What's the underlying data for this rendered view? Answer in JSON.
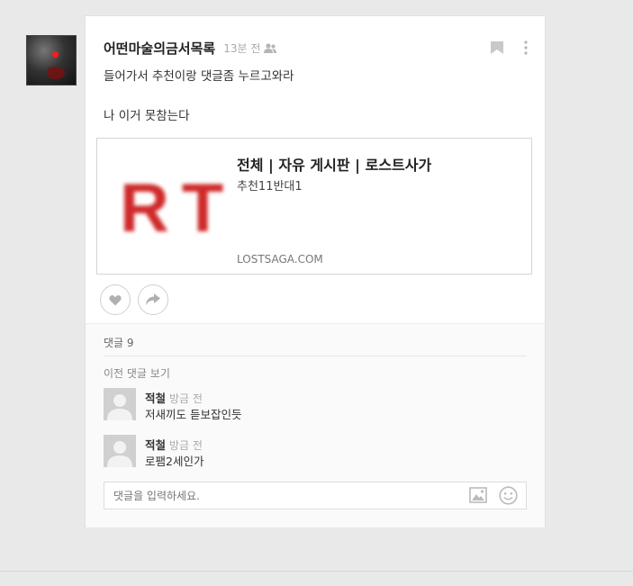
{
  "post": {
    "author": "어떤마술의금서목록",
    "time": "13분 전",
    "lines": [
      "들어가서 추천이랑 댓글좀 누르고와라",
      "나 이거 못참는다"
    ],
    "link": {
      "logo_text": "RT",
      "title": "전체 | 자유 게시판 | 로스트사가",
      "description": "추천11반대1",
      "domain": "LOSTSAGA.COM"
    }
  },
  "comments": {
    "count_label": "댓글 9",
    "prev_label": "이전 댓글 보기",
    "items": [
      {
        "author": "적철",
        "time": "방금 전",
        "text": "저새끼도 듣보잡인듯"
      },
      {
        "author": "적철",
        "time": "방금 전",
        "text": "로팸2세인가"
      }
    ],
    "input_placeholder": "댓글을 입력하세요."
  },
  "colors": {
    "accent": "#cf2a2a",
    "background": "#e9e9e9"
  }
}
